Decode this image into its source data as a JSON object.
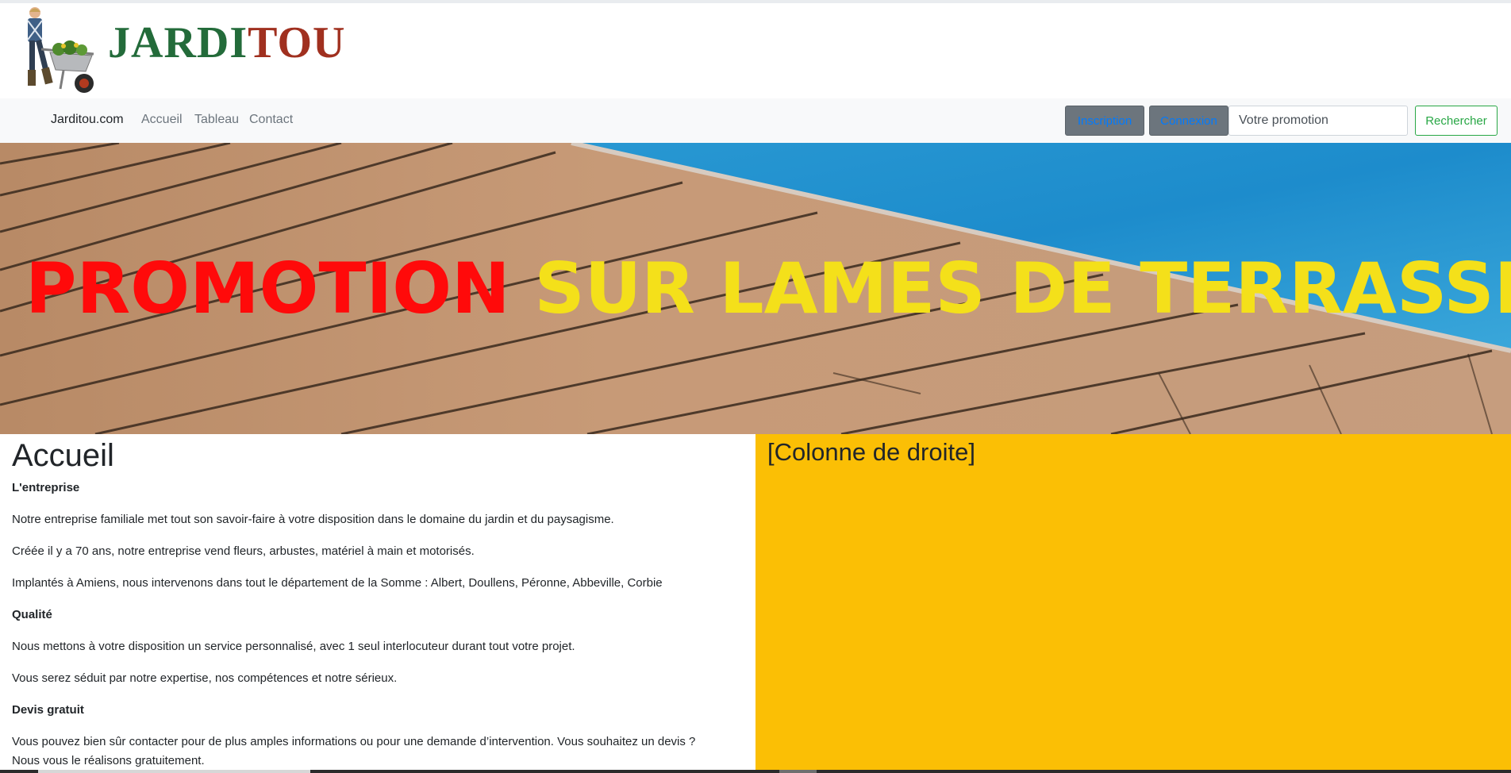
{
  "logo": {
    "part1": "JARDI",
    "part2": "TOU"
  },
  "navbar": {
    "brand": "Jarditou.com",
    "links": [
      "Accueil",
      "Tableau",
      "Contact"
    ],
    "inscription_label": "Inscription",
    "connexion_label": "Connexion",
    "search_placeholder": "Votre promotion",
    "search_button": "Rechercher"
  },
  "banner": {
    "word1": "PROMOTION",
    "word2": "SUR LAMES DE TERRASSE"
  },
  "main": {
    "title": "Accueil",
    "sections": [
      {
        "heading": "L'entreprise"
      },
      {
        "p1": "Notre entreprise familiale met tout son savoir-faire à votre disposition dans le domaine du jardin et du paysagisme."
      },
      {
        "p2": "Créée il y a 70 ans, notre entreprise vend fleurs, arbustes, matériel à main et motorisés."
      },
      {
        "p3": "Implantés à Amiens, nous intervenons dans tout le département de la Somme : Albert, Doullens, Péronne, Abbeville, Corbie"
      }
    ],
    "heading_qualite": "Qualité",
    "qualite_p1": "Nous mettons à votre disposition un service personnalisé, avec 1 seul interlocuteur durant tout votre projet.",
    "qualite_p2": "Vous serez séduit par notre expertise, nos compétences et notre sérieux.",
    "heading_devis": "Devis gratuit",
    "devis_line1": "Vous pouvez bien sûr contacter pour de plus amples informations ou pour une demande d’intervention. Vous souhaitez un devis ?",
    "devis_line2": "Nous vous le réalisons gratuitement."
  },
  "right_column": {
    "title": "[Colonne de droite]"
  },
  "colors": {
    "sidebar_yellow": "#fbbf05",
    "logo_green": "#236b3a",
    "logo_red": "#a0301f",
    "search_green": "#28a745"
  }
}
